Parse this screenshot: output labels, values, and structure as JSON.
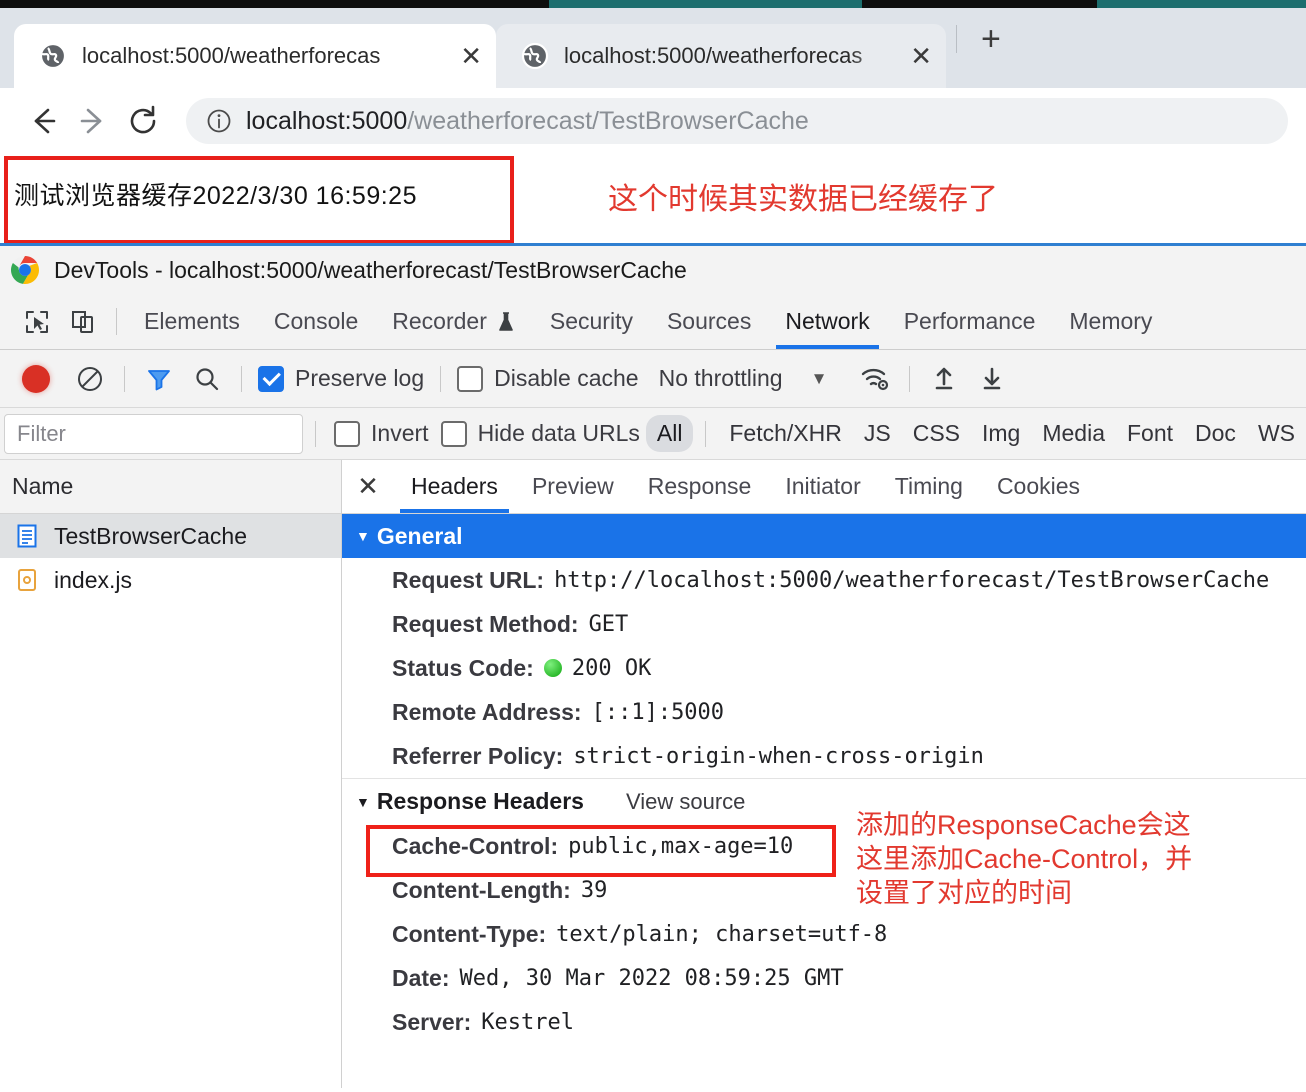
{
  "browser": {
    "tabs": [
      {
        "title": "localhost:5000/weatherforecas",
        "favicon": "globe-icon",
        "close_label": "✕",
        "active": true
      },
      {
        "title": "localhost:5000/weatherforecas",
        "favicon": "globe-icon",
        "close_label": "✕",
        "active": false
      }
    ],
    "new_tab_label": "+",
    "nav": {
      "back": "back-arrow",
      "forward": "forward-arrow",
      "reload": "reload-icon"
    },
    "omnibox": {
      "info_icon": "info-circle-icon",
      "host": "localhost:5000",
      "path": "/weatherforecast/TestBrowserCache",
      "full_url": "localhost:5000/weatherforecast/TestBrowserCache"
    }
  },
  "page": {
    "body_text": "测试浏览器缓存2022/3/30  16:59:25",
    "annotation": "这个时候其实数据已经缓存了"
  },
  "devtools": {
    "window_title": "DevTools - localhost:5000/weatherforecast/TestBrowserCache",
    "panels": [
      {
        "label": "Elements",
        "active": false
      },
      {
        "label": "Console",
        "active": false
      },
      {
        "label": "Recorder",
        "active": false,
        "badge": "flask-icon"
      },
      {
        "label": "Security",
        "active": false
      },
      {
        "label": "Sources",
        "active": false
      },
      {
        "label": "Network",
        "active": true
      },
      {
        "label": "Performance",
        "active": false
      },
      {
        "label": "Memory",
        "active": false
      }
    ],
    "toolbar": {
      "record_button": "record-dot-icon",
      "clear_button": "clear-icon",
      "filter_button": "funnel-icon",
      "search_button": "search-icon",
      "preserve_log": {
        "label": "Preserve log",
        "checked": true
      },
      "disable_cache": {
        "label": "Disable cache",
        "checked": false
      },
      "throttling": "No throttling",
      "throttling_caret": "▼",
      "network_conditions_icon": "wifi-settings-icon",
      "import_icon": "upload-arrow-icon",
      "export_icon": "download-arrow-icon"
    },
    "filterbar": {
      "filter_placeholder": "Filter",
      "invert": {
        "label": "Invert",
        "checked": false
      },
      "hide_data_urls": {
        "label": "Hide data URLs",
        "checked": false
      },
      "types": [
        {
          "label": "All",
          "selected": true
        },
        {
          "label": "Fetch/XHR",
          "selected": false
        },
        {
          "label": "JS",
          "selected": false
        },
        {
          "label": "CSS",
          "selected": false
        },
        {
          "label": "Img",
          "selected": false
        },
        {
          "label": "Media",
          "selected": false
        },
        {
          "label": "Font",
          "selected": false
        },
        {
          "label": "Doc",
          "selected": false
        },
        {
          "label": "WS",
          "selected": false
        }
      ]
    },
    "request_list": {
      "column_header": "Name",
      "rows": [
        {
          "name": "TestBrowserCache",
          "icon": "document-icon",
          "selected": true
        },
        {
          "name": "index.js",
          "icon": "script-icon",
          "selected": false
        }
      ]
    },
    "detail": {
      "close_label": "✕",
      "tabs": [
        {
          "label": "Headers",
          "active": true
        },
        {
          "label": "Preview",
          "active": false
        },
        {
          "label": "Response",
          "active": false
        },
        {
          "label": "Initiator",
          "active": false
        },
        {
          "label": "Timing",
          "active": false
        },
        {
          "label": "Cookies",
          "active": false
        }
      ],
      "general": {
        "title": "General",
        "triangle": "▼",
        "rows": [
          {
            "name": "Request URL:",
            "value": "http://localhost:5000/weatherforecast/TestBrowserCache"
          },
          {
            "name": "Request Method:",
            "value": "GET"
          },
          {
            "name": "Status Code:",
            "value": "200 OK",
            "status_dot": true
          },
          {
            "name": "Remote Address:",
            "value": "[::1]:5000"
          },
          {
            "name": "Referrer Policy:",
            "value": "strict-origin-when-cross-origin"
          }
        ]
      },
      "response_headers": {
        "title": "Response Headers",
        "triangle": "▼",
        "view_source": "View source",
        "rows": [
          {
            "name": "Cache-Control:",
            "value": "public,max-age=10",
            "highlighted": true
          },
          {
            "name": "Content-Length:",
            "value": "39"
          },
          {
            "name": "Content-Type:",
            "value": "text/plain; charset=utf-8"
          },
          {
            "name": "Date:",
            "value": "Wed, 30 Mar 2022 08:59:25 GMT"
          },
          {
            "name": "Server:",
            "value": "Kestrel"
          }
        ],
        "annotation_lines": [
          "添加的ResponseCache会这",
          "这里添加Cache-Control，并",
          "设置了对应的时间"
        ]
      }
    }
  },
  "colors": {
    "accent_blue": "#1a73e8",
    "annotation_red": "#e2392f",
    "box_red": "#ef2119",
    "status_green": "#18c018",
    "record_red": "#d93025"
  }
}
